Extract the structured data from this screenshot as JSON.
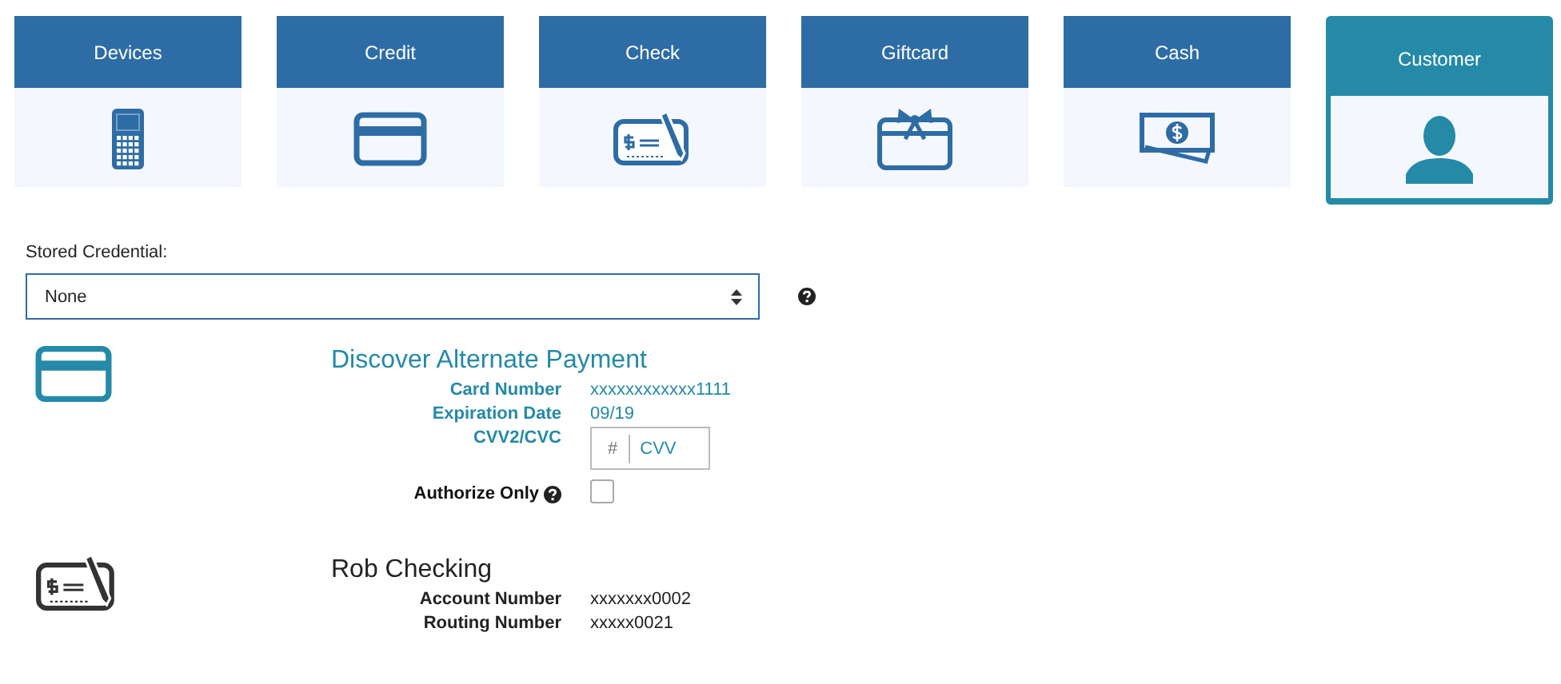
{
  "tiles": [
    {
      "label": "Devices",
      "kind": "phone",
      "selected": false
    },
    {
      "label": "Credit",
      "kind": "card",
      "selected": false
    },
    {
      "label": "Check",
      "kind": "check",
      "selected": false
    },
    {
      "label": "Giftcard",
      "kind": "gift",
      "selected": false
    },
    {
      "label": "Cash",
      "kind": "cash",
      "selected": false
    },
    {
      "label": "Customer",
      "kind": "person",
      "selected": true
    }
  ],
  "stored_credential": {
    "label": "Stored Credential:",
    "value": "None"
  },
  "accounts": [
    {
      "kind": "card",
      "title": "Discover Alternate Payment",
      "selected": true,
      "fields": [
        {
          "kind": "text",
          "label": "Card Number",
          "value": "xxxxxxxxxxxx1111"
        },
        {
          "kind": "text",
          "label": "Expiration Date",
          "value": "09/19"
        },
        {
          "kind": "cvv",
          "label": "CVV2/CVC",
          "prefix": "#",
          "placeholder": "CVV"
        },
        {
          "kind": "checkbox",
          "label": "Authorize Only",
          "checked": false
        }
      ]
    },
    {
      "kind": "check",
      "title": "Rob Checking",
      "selected": false,
      "fields": [
        {
          "kind": "text",
          "label": "Account Number",
          "value": "xxxxxxx0002"
        },
        {
          "kind": "text",
          "label": "Routing Number",
          "value": "xxxxx0021"
        }
      ]
    }
  ]
}
